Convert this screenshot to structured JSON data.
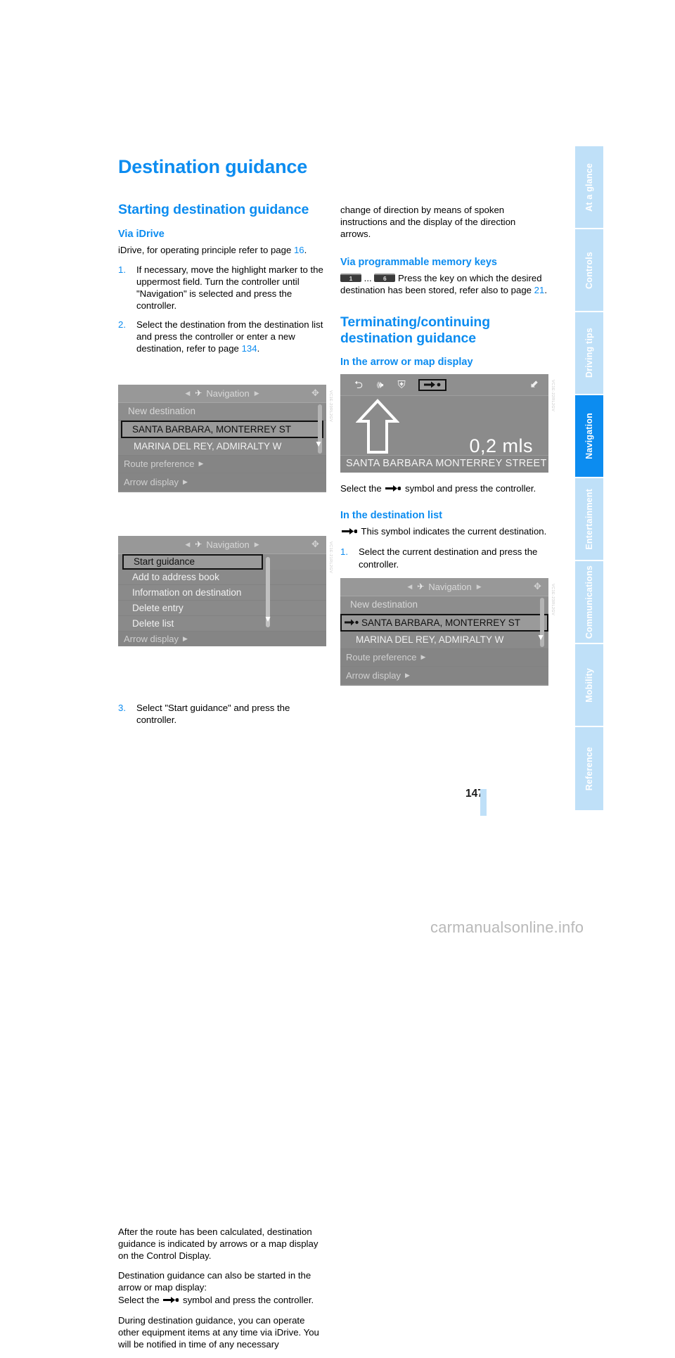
{
  "document": {
    "title": "Destination guidance",
    "page_number": "147",
    "watermark": "carmanualsonline.info"
  },
  "sidebar": {
    "tabs": [
      {
        "label": "At a glance",
        "active": false
      },
      {
        "label": "Controls",
        "active": false
      },
      {
        "label": "Driving tips",
        "active": false
      },
      {
        "label": "Navigation",
        "active": true
      },
      {
        "label": "Entertainment",
        "active": false
      },
      {
        "label": "Communications",
        "active": false
      },
      {
        "label": "Mobility",
        "active": false
      },
      {
        "label": "Reference",
        "active": false
      }
    ],
    "active_color": "#0c8cf0",
    "inactive_color": "#bfe0f8"
  },
  "left_column": {
    "section_heading": "Starting destination guidance",
    "sub_heading_1": "Via iDrive",
    "intro": "iDrive, for operating principle refer to page ",
    "intro_ref": "16",
    "intro_end": ".",
    "steps": [
      {
        "num": "1.",
        "text": "If necessary, move the highlight marker to the uppermost field. Turn the controller until \"Navigation\" is selected and press the controller."
      },
      {
        "num": "2.",
        "text": "Select the destination from the destination list and press the controller or enter a new destination, refer to page ",
        "ref": "134",
        "text_end": "."
      }
    ],
    "step3": {
      "num": "3.",
      "text": "Select \"Start guidance\" and press the controller."
    },
    "para_after_route": "After the route has been calculated, destination guidance is indicated by arrows or a map display on the Control Display.",
    "para_started_a": "Destination guidance can also be started in the arrow or map display:",
    "para_started_b_pre": "Select the ",
    "para_started_b_post": " symbol and press the controller.",
    "para_during": "During destination guidance, you can operate other equipment items at any time via iDrive. You will be notified in time of any necessary"
  },
  "right_column": {
    "continued_text": "change of direction by means of spoken instructions and the display of the direction arrows.",
    "sub_heading_memory": "Via programmable memory keys",
    "memory_key_first": "1",
    "memory_key_ellipsis": "...",
    "memory_key_last": "6",
    "memory_text": "Press the key on which the desired destination has been stored, refer also to page ",
    "memory_ref": "21",
    "memory_text_end": ".",
    "section_heading": "Terminating/continuing destination guidance",
    "sub_heading_arrow": "In the arrow or map display",
    "select_symbol_pre": "Select the ",
    "select_symbol_post": " symbol and press the controller.",
    "sub_heading_list": "In the destination list",
    "symbol_note": " This symbol indicates the current destination.",
    "step1": {
      "num": "1.",
      "text": "Select the current destination and press the controller."
    }
  },
  "screens": {
    "nav_menu_1": {
      "header_title": "Navigation",
      "rows": [
        {
          "label": "New destination",
          "state": "dim"
        },
        {
          "label": "SANTA BARBARA, MONTERREY ST",
          "state": "selected"
        },
        {
          "label": "MARINA DEL REY, ADMIRALTY W",
          "state": "normal"
        }
      ],
      "footer_rows": [
        {
          "label": "Route preference"
        },
        {
          "label": "Arrow display"
        }
      ],
      "id_code": "VC1E-20RL2GV"
    },
    "nav_menu_2": {
      "header_title": "Navigation",
      "rows": [
        {
          "label": "Start guidance",
          "state": "selected"
        },
        {
          "label": "Add to address book",
          "state": "normal"
        },
        {
          "label": "Information on destination",
          "state": "normal"
        },
        {
          "label": "Delete entry",
          "state": "normal"
        },
        {
          "label": "Delete list",
          "state": "normal"
        }
      ],
      "footer_rows": [
        {
          "label": "Arrow display"
        }
      ],
      "id_code": "VC1E-21RL2GV"
    },
    "arrow_display": {
      "toolbar_icons": [
        "back-icon",
        "speaker-icon",
        "highway-icon",
        "destination-icon",
        "corner-arrow-icon"
      ],
      "distance": "0,2 mls",
      "street": "SANTA BARBARA MONTERREY STREET",
      "id_code": "VC1E-22RL2GV"
    },
    "nav_menu_3": {
      "header_title": "Navigation",
      "rows": [
        {
          "label": "New destination",
          "state": "dim"
        },
        {
          "label": "SANTA BARBARA, MONTERREY ST",
          "state": "selected-dest"
        },
        {
          "label": "MARINA DEL REY, ADMIRALTY W",
          "state": "normal"
        }
      ],
      "footer_rows": [
        {
          "label": "Route preference"
        },
        {
          "label": "Arrow display"
        }
      ],
      "id_code": "VC1E-23RL2GV"
    }
  }
}
